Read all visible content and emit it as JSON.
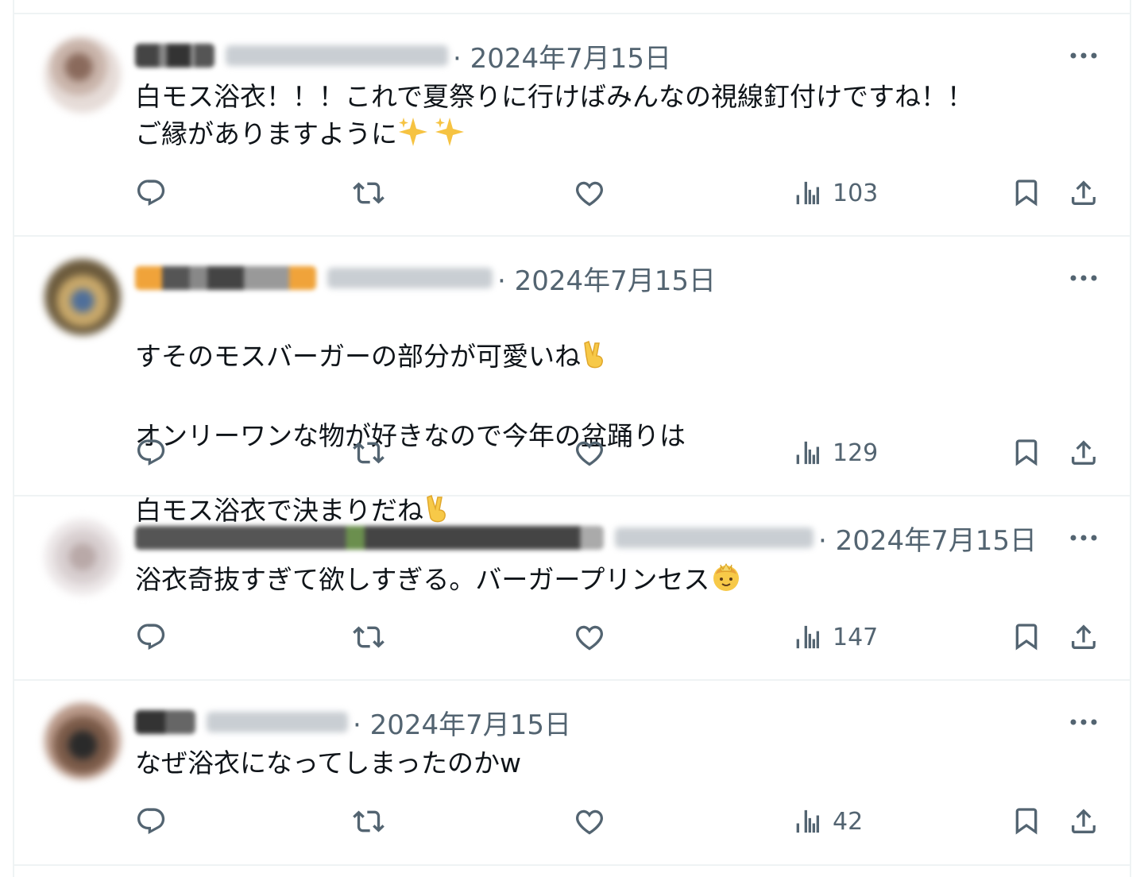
{
  "posts": [
    {
      "date": "2024年7月15日",
      "dot": "·",
      "lines": "白モス浴衣！！！これで夏祭りに行けばみんなの視線釘付けですね！！\nご縁がありますように",
      "trailing_emoji": "sparkles",
      "views": "103"
    },
    {
      "date": "2024年7月15日",
      "dot": "·",
      "line1": "すそのモスバーガーの部分が可愛いね",
      "line2": "オンリーワンな物が好きなので今年の盆踊りは",
      "line3": "白モス浴衣で決まりだね",
      "views": "129"
    },
    {
      "date": "2024年7月15日",
      "dot": "·",
      "lines": "浴衣奇抜すぎて欲しすぎる。バーガープリンセス",
      "trailing_emoji": "princess",
      "views": "147"
    },
    {
      "date": "2024年7月15日",
      "dot": "·",
      "lines": "なぜ浴衣になってしまったのかw",
      "views": "42"
    }
  ],
  "icons": {
    "reply": "reply-icon",
    "repost": "repost-icon",
    "like": "heart-icon",
    "views": "views-bar-chart-icon",
    "bookmark": "bookmark-icon",
    "share": "share-upload-icon",
    "more": "more-dots-icon"
  },
  "colors": {
    "text": "#0f1419",
    "secondary": "#536471",
    "divider": "#eff3f4"
  }
}
